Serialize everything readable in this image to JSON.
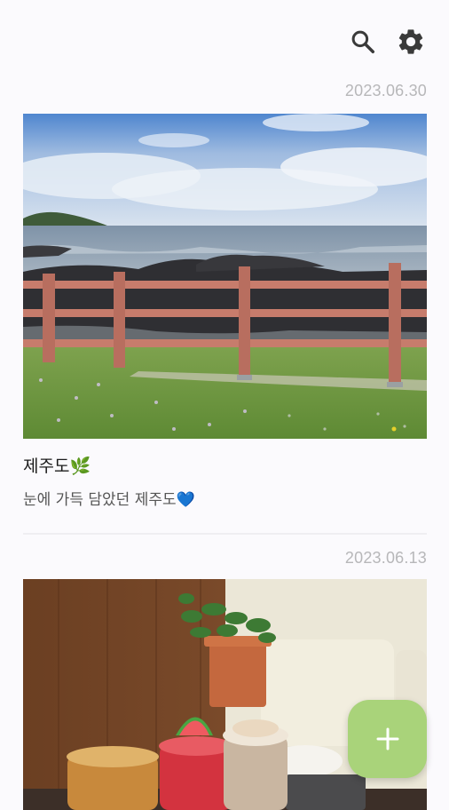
{
  "toolbar": {
    "search_icon": "search-icon",
    "settings_icon": "gear-icon"
  },
  "entries": [
    {
      "date": "2023.06.30",
      "title": "제주도🌿",
      "body": "눈에 가득 담았던 제주도💙"
    },
    {
      "date": "2023.06.13"
    }
  ],
  "fab": {
    "icon": "plus-icon",
    "label": "+"
  },
  "colors": {
    "background": "#fbfafd",
    "date_text": "#b7b7b9",
    "fab": "#a9d37a",
    "icon": "#3a3a3a"
  }
}
